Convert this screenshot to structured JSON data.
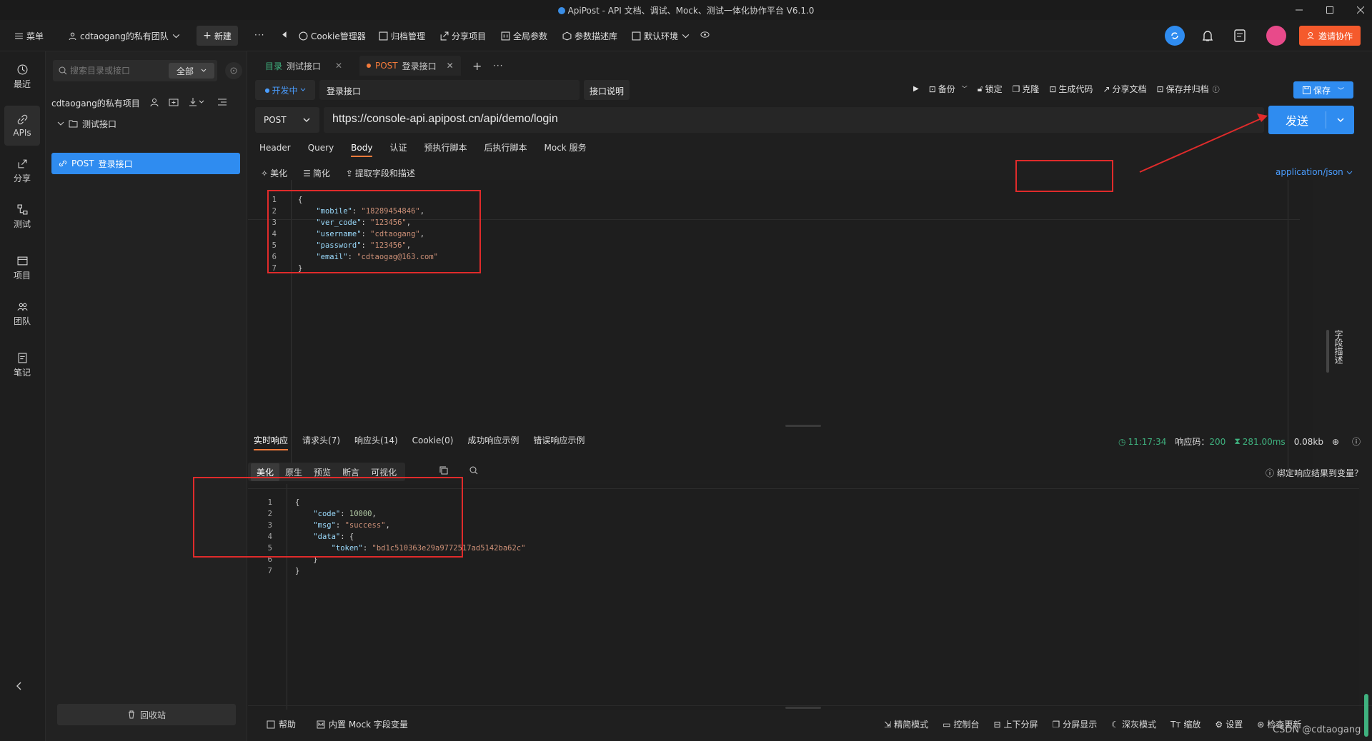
{
  "window": {
    "title": "ApiPost - API 文档、调试、Mock、测试一体化协作平台 V6.1.0"
  },
  "toolbar": {
    "menu": "菜单",
    "team": "cdtaogang的私有团队",
    "new": "新建",
    "items": [
      "Cookie管理器",
      "归档管理",
      "分享项目",
      "全局参数",
      "参数描述库",
      "默认环境"
    ],
    "invite": "邀请协作"
  },
  "leftnav": [
    {
      "label": "最近",
      "icon": "clock-icon"
    },
    {
      "label": "APIs",
      "icon": "link-icon",
      "active": true
    },
    {
      "label": "分享",
      "icon": "share-icon"
    },
    {
      "label": "测试",
      "icon": "flow-icon"
    },
    {
      "label": "项目",
      "icon": "folder-icon"
    },
    {
      "label": "团队",
      "icon": "team-icon"
    },
    {
      "label": "笔记",
      "icon": "note-icon"
    }
  ],
  "sidebar": {
    "search_placeholder": "搜索目录或接口",
    "filter": "全部",
    "project": "cdtaogang的私有项目",
    "folder": "测试接口",
    "api": {
      "method": "POST",
      "name": "登录接口"
    },
    "trash": "回收站"
  },
  "tabs": [
    {
      "prefix": "目录",
      "label": "测试接口"
    },
    {
      "prefix": "POST",
      "label": "登录接口"
    }
  ],
  "request": {
    "status": "开发中",
    "name": "登录接口",
    "desc_button": "接口说明",
    "actions": [
      "备份",
      "锁定",
      "克隆",
      "生成代码",
      "分享文档",
      "保存并归档"
    ],
    "save": "保存",
    "method": "POST",
    "url": "https://console-api.apipost.cn/api/demo/login",
    "send": "发送",
    "subtabs": [
      "Header",
      "Query",
      "Body",
      "认证",
      "预执行脚本",
      "后执行脚本",
      "Mock 服务"
    ],
    "body_tools": [
      "美化",
      "简化",
      "提取字段和描述"
    ],
    "content_type": "application/json",
    "side_label": "字段描述",
    "body_lines": [
      "{",
      "    \"mobile\": \"18289454846\",",
      "    \"ver_code\": \"123456\",",
      "    \"username\": \"cdtaogang\",",
      "    \"password\": \"123456\",",
      "    \"email\": \"cdtaogag@163.com\"",
      "}"
    ]
  },
  "response": {
    "tabs": [
      "实时响应",
      "请求头(7)",
      "响应头(14)",
      "Cookie(0)",
      "成功响应示例",
      "错误响应示例"
    ],
    "time": "11:17:34",
    "code_label": "响应码：",
    "code": "200",
    "duration": "281.00ms",
    "size": "0.08kb",
    "view_tabs": [
      "美化",
      "原生",
      "预览",
      "断言",
      "可视化"
    ],
    "bind": "绑定响应结果到变量？",
    "body_lines": [
      "{",
      "    \"code\": 10000,",
      "    \"msg\": \"success\",",
      "    \"data\": {",
      "        \"token\": \"bd1c510363e29a9772517ad5142ba62c\"",
      "    }",
      "}"
    ]
  },
  "footer": {
    "left": [
      "帮助",
      "内置 Mock 字段变量"
    ],
    "right": [
      "精简模式",
      "控制台",
      "上下分屏",
      "分屏显示",
      "深灰模式",
      "缩放",
      "设置",
      "检查更新"
    ]
  },
  "watermark": "CSDN @cdtaogang",
  "colors": {
    "accent": "#2f8cf0",
    "annotation": "#e02b2b",
    "post": "#f47b3b",
    "success": "#3fb27f"
  }
}
